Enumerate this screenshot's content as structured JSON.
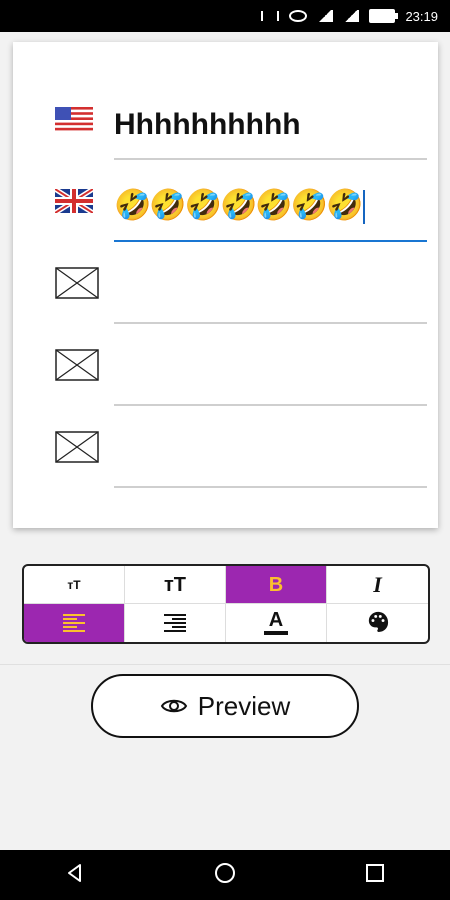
{
  "status_bar": {
    "time": "23:19",
    "icons": [
      "vibrate-icon",
      "eye-icon",
      "signal-icon",
      "signal-icon",
      "battery-icon"
    ]
  },
  "translations": [
    {
      "flag": "us-flag-icon",
      "text": "Hhhhhhhhhh",
      "active": false
    },
    {
      "flag": "uk-flag-icon",
      "text": "🤣🤣🤣🤣🤣🤣🤣",
      "active": true
    },
    {
      "flag": "missing-image-icon",
      "text": "",
      "active": false
    },
    {
      "flag": "missing-image-icon",
      "text": "",
      "active": false
    },
    {
      "flag": "missing-image-icon",
      "text": "",
      "active": false
    }
  ],
  "toolbar": {
    "bold_label": "B",
    "italic_label": "I",
    "font_color_label": "A",
    "text_size_small_label": "ᴛT",
    "text_size_big_label": "ᴛT",
    "active_buttons": [
      "bold",
      "align-left"
    ],
    "accent_color": "#9c27b0",
    "active_glyph_color": "#fbc02d"
  },
  "preview": {
    "label": "Preview"
  },
  "nav": {
    "icons": [
      "back-icon",
      "home-icon",
      "recents-icon"
    ]
  }
}
